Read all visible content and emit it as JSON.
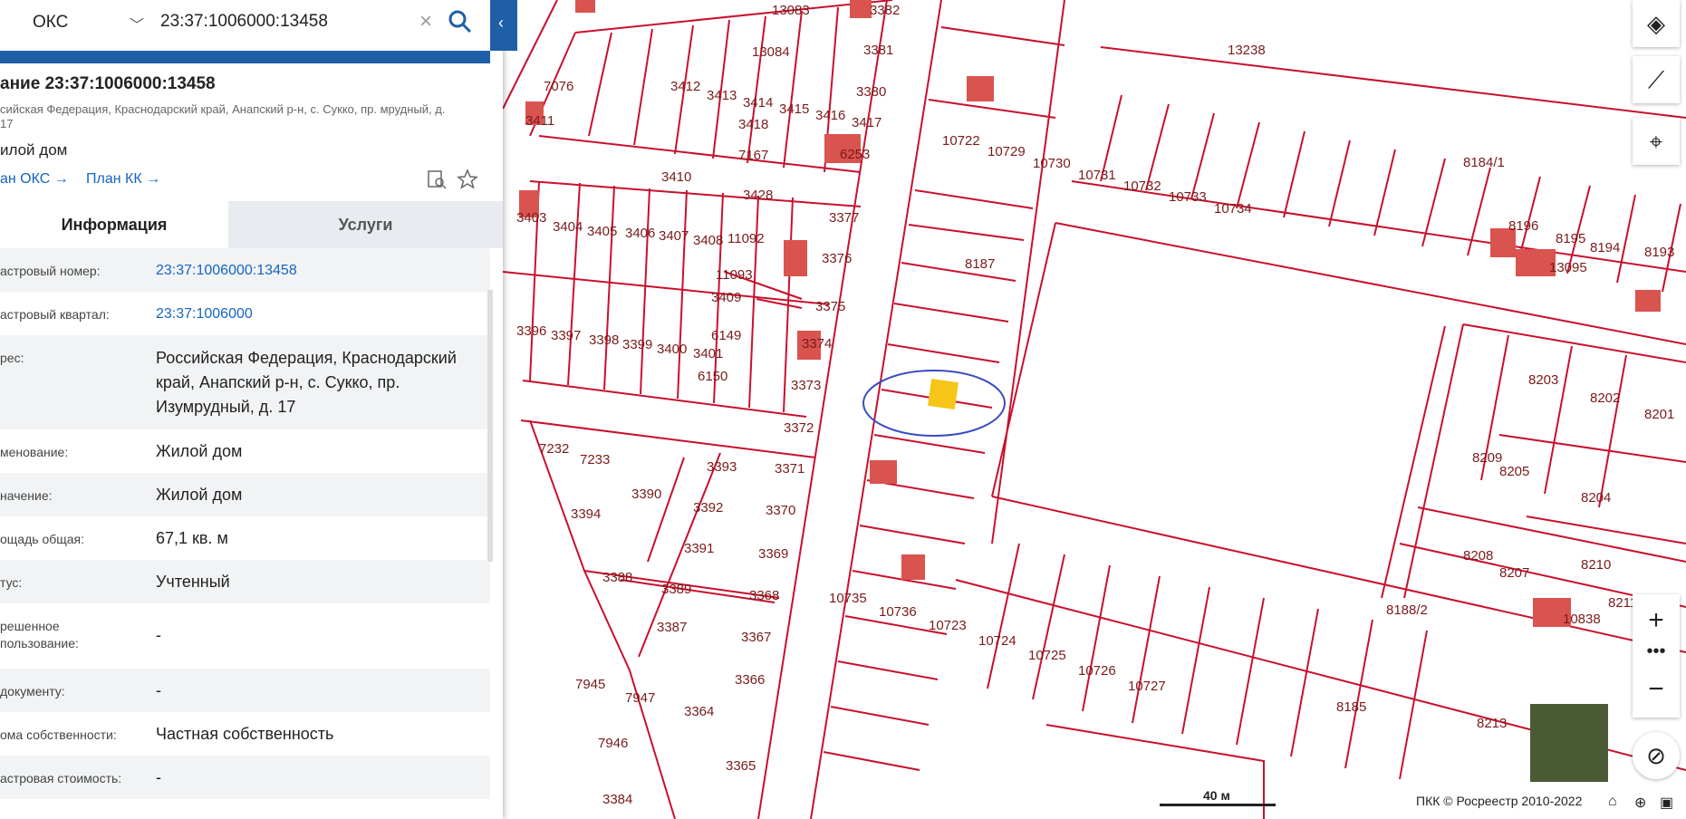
{
  "search": {
    "type_label": "ОКС",
    "query": "23:37:1006000:13458"
  },
  "object": {
    "title": "ание 23:37:1006000:13458",
    "address_short": "сийская Федерация, Краснодарский край, Анапский р-н, с. Сукко, пр. мрудный, д. 17",
    "type": "илой дом",
    "plan_oks": "ан ОКС →",
    "plan_kk": "План КК →"
  },
  "tabs": {
    "info": "Информация",
    "services": "Услуги"
  },
  "rows": [
    {
      "label": "астровый номер:",
      "value": "23:37:1006000:13458",
      "link": true
    },
    {
      "label": "астровый квартал:",
      "value": "23:37:1006000",
      "link": true
    },
    {
      "label": "рес:",
      "value": "Российская Федерация, Краснодарский край, Анапский р-н, с. Сукко, пр. Изумрудный, д. 17",
      "link": false
    },
    {
      "label": "менование:",
      "value": "Жилой дом",
      "link": false
    },
    {
      "label": "начение:",
      "value": "Жилой дом",
      "link": false
    },
    {
      "label": "ощадь общая:",
      "value": "67,1 кв. м",
      "link": false
    },
    {
      "label": "тус:",
      "value": "Учтенный",
      "link": false
    },
    {
      "label": "решенное пользование:",
      "value": "-",
      "link": false
    },
    {
      "label": "документу:",
      "value": "-",
      "link": false
    },
    {
      "label": "ома собственности:",
      "value": "Частная собственность",
      "link": false
    },
    {
      "label": "астровая стоимость:",
      "value": "-",
      "link": false
    }
  ],
  "map": {
    "parcel_labels": [
      "3382",
      "13083",
      "13238",
      "3381",
      "13084",
      "3380",
      "3418",
      "7167",
      "6253",
      "3428",
      "3377",
      "3376",
      "3375",
      "3374",
      "3373",
      "3372",
      "3371",
      "3370",
      "3369",
      "3368",
      "3367",
      "3366",
      "3365",
      "3364",
      "3396",
      "3397",
      "3398",
      "3399",
      "3400",
      "3401",
      "3403",
      "3404",
      "3405",
      "3406",
      "3407",
      "3408",
      "3409",
      "11092",
      "11093",
      "6149",
      "6150",
      "3393",
      "3392",
      "3391",
      "3390",
      "3394",
      "3388",
      "3389",
      "3387",
      "7233",
      "7232",
      "7945",
      "7947",
      "7946",
      "3384",
      "8187",
      "8184/1",
      "8196",
      "8195",
      "13095",
      "8194",
      "8193",
      "8203",
      "8202",
      "8201",
      "8205",
      "8204",
      "8209",
      "8208",
      "8207",
      "8210",
      "8211",
      "10838",
      "8188/2",
      "8185",
      "8213",
      "10722",
      "10729",
      "10730",
      "10731",
      "10732",
      "10733",
      "10734",
      "10735",
      "10736",
      "10723",
      "10724",
      "10725",
      "10726",
      "10727",
      "3410",
      "3412",
      "3413",
      "3414",
      "3415",
      "3416",
      "3417",
      "7076",
      "3411"
    ],
    "scale_label": "40 м",
    "copyright": "ПКК © Росреестр 2010-2022"
  },
  "colors": {
    "parcel_stroke": "#c8102e",
    "building_fill": "#d9534f",
    "selected_fill": "#f5c518",
    "highlight_ellipse": "#3b4cc0",
    "panel_accent": "#1f5fa8",
    "link": "#1565c0"
  },
  "icons": {
    "layers": "layers-icon",
    "ruler": "ruler-icon",
    "locate": "crosshair-icon",
    "zoom_in": "plus-icon",
    "zoom_out": "minus-icon",
    "compass": "compass-icon"
  }
}
